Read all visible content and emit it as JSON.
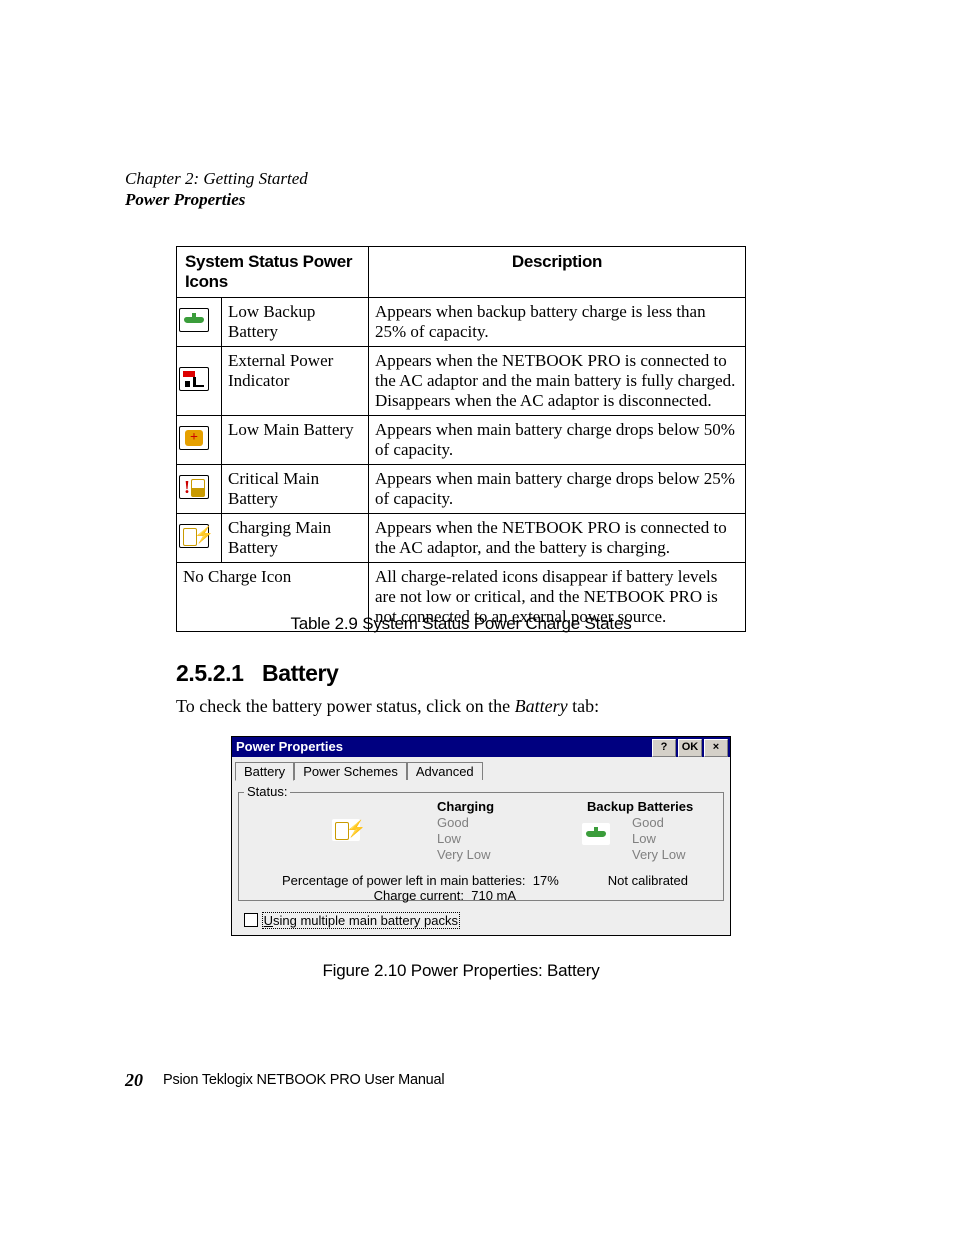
{
  "header": {
    "chapter": "Chapter 2:  Getting Started",
    "section": "Power Properties"
  },
  "table": {
    "head_icons": "System Status Power Icons",
    "head_desc": "Description",
    "rows": [
      {
        "label": "Low Backup Battery",
        "desc": "Appears when backup battery charge is less than 25% of capacity."
      },
      {
        "label": "External Power Indicator",
        "desc": "Appears when the NETBOOK PRO is connected to the AC adaptor and the main battery is fully charged. Disappears when the AC adaptor is disconnected."
      },
      {
        "label": "Low Main Battery",
        "desc": "Appears when main battery charge drops below 50% of capacity."
      },
      {
        "label": "Critical Main Battery",
        "desc": "Appears when main battery charge drops below 25% of capacity."
      },
      {
        "label": "Charging Main Battery",
        "desc": "Appears when the NETBOOK PRO is connected to the AC adaptor, and the battery is charging."
      },
      {
        "label": "No Charge Icon",
        "desc": "All charge-related icons disappear if battery levels are not low or critical, and the NETBOOK PRO is not connected to an external power source."
      }
    ],
    "caption": "Table 2.9 System Status Power Charge States"
  },
  "section": {
    "number": "2.5.2.1",
    "title": "Battery",
    "body_pre": "To check the battery power status, click on the ",
    "body_em": "Battery",
    "body_post": " tab:"
  },
  "dialog": {
    "title": "Power Properties",
    "btn_help": "?",
    "btn_ok": "OK",
    "btn_close": "×",
    "tabs": [
      "Battery",
      "Power Schemes",
      "Advanced"
    ],
    "group_label": "Status:",
    "main_head": "Charging",
    "backup_head": "Backup Batteries",
    "states": [
      "Good",
      "Low",
      "Very Low"
    ],
    "main_selected_index": 2,
    "backup_selected_index": 1,
    "pct_label": "Percentage of power left in main batteries:",
    "pct_value": "17%",
    "cur_label": "Charge current:",
    "cur_value": "710 mA",
    "not_calibrated": "Not calibrated",
    "checkbox_label_u": "U",
    "checkbox_label_rest": "sing multiple main battery packs"
  },
  "figure_caption": "Figure 2.10 Power Properties: Battery",
  "footer": {
    "page": "20",
    "doc": "Psion Teklogix NETBOOK PRO User Manual"
  }
}
